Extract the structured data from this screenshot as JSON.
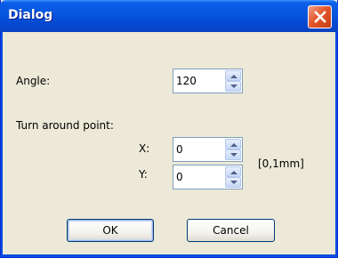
{
  "window": {
    "title": "Dialog"
  },
  "form": {
    "angle_label": "Angle:",
    "angle_value": "120",
    "turn_label": "Turn around point:",
    "x_label": "X:",
    "x_value": "0",
    "y_label": "Y:",
    "y_value": "0",
    "unit_label": "[0,1mm]"
  },
  "buttons": {
    "ok_label": "OK",
    "cancel_label": "Cancel"
  },
  "icons": {
    "close": "close-icon",
    "spin_up": "arrow-up-icon",
    "spin_down": "arrow-down-icon"
  },
  "colors": {
    "titlebar": "#0855dd",
    "close_button": "#e3582c",
    "dialog_background": "#ece9d8",
    "input_border": "#7f9db9"
  }
}
